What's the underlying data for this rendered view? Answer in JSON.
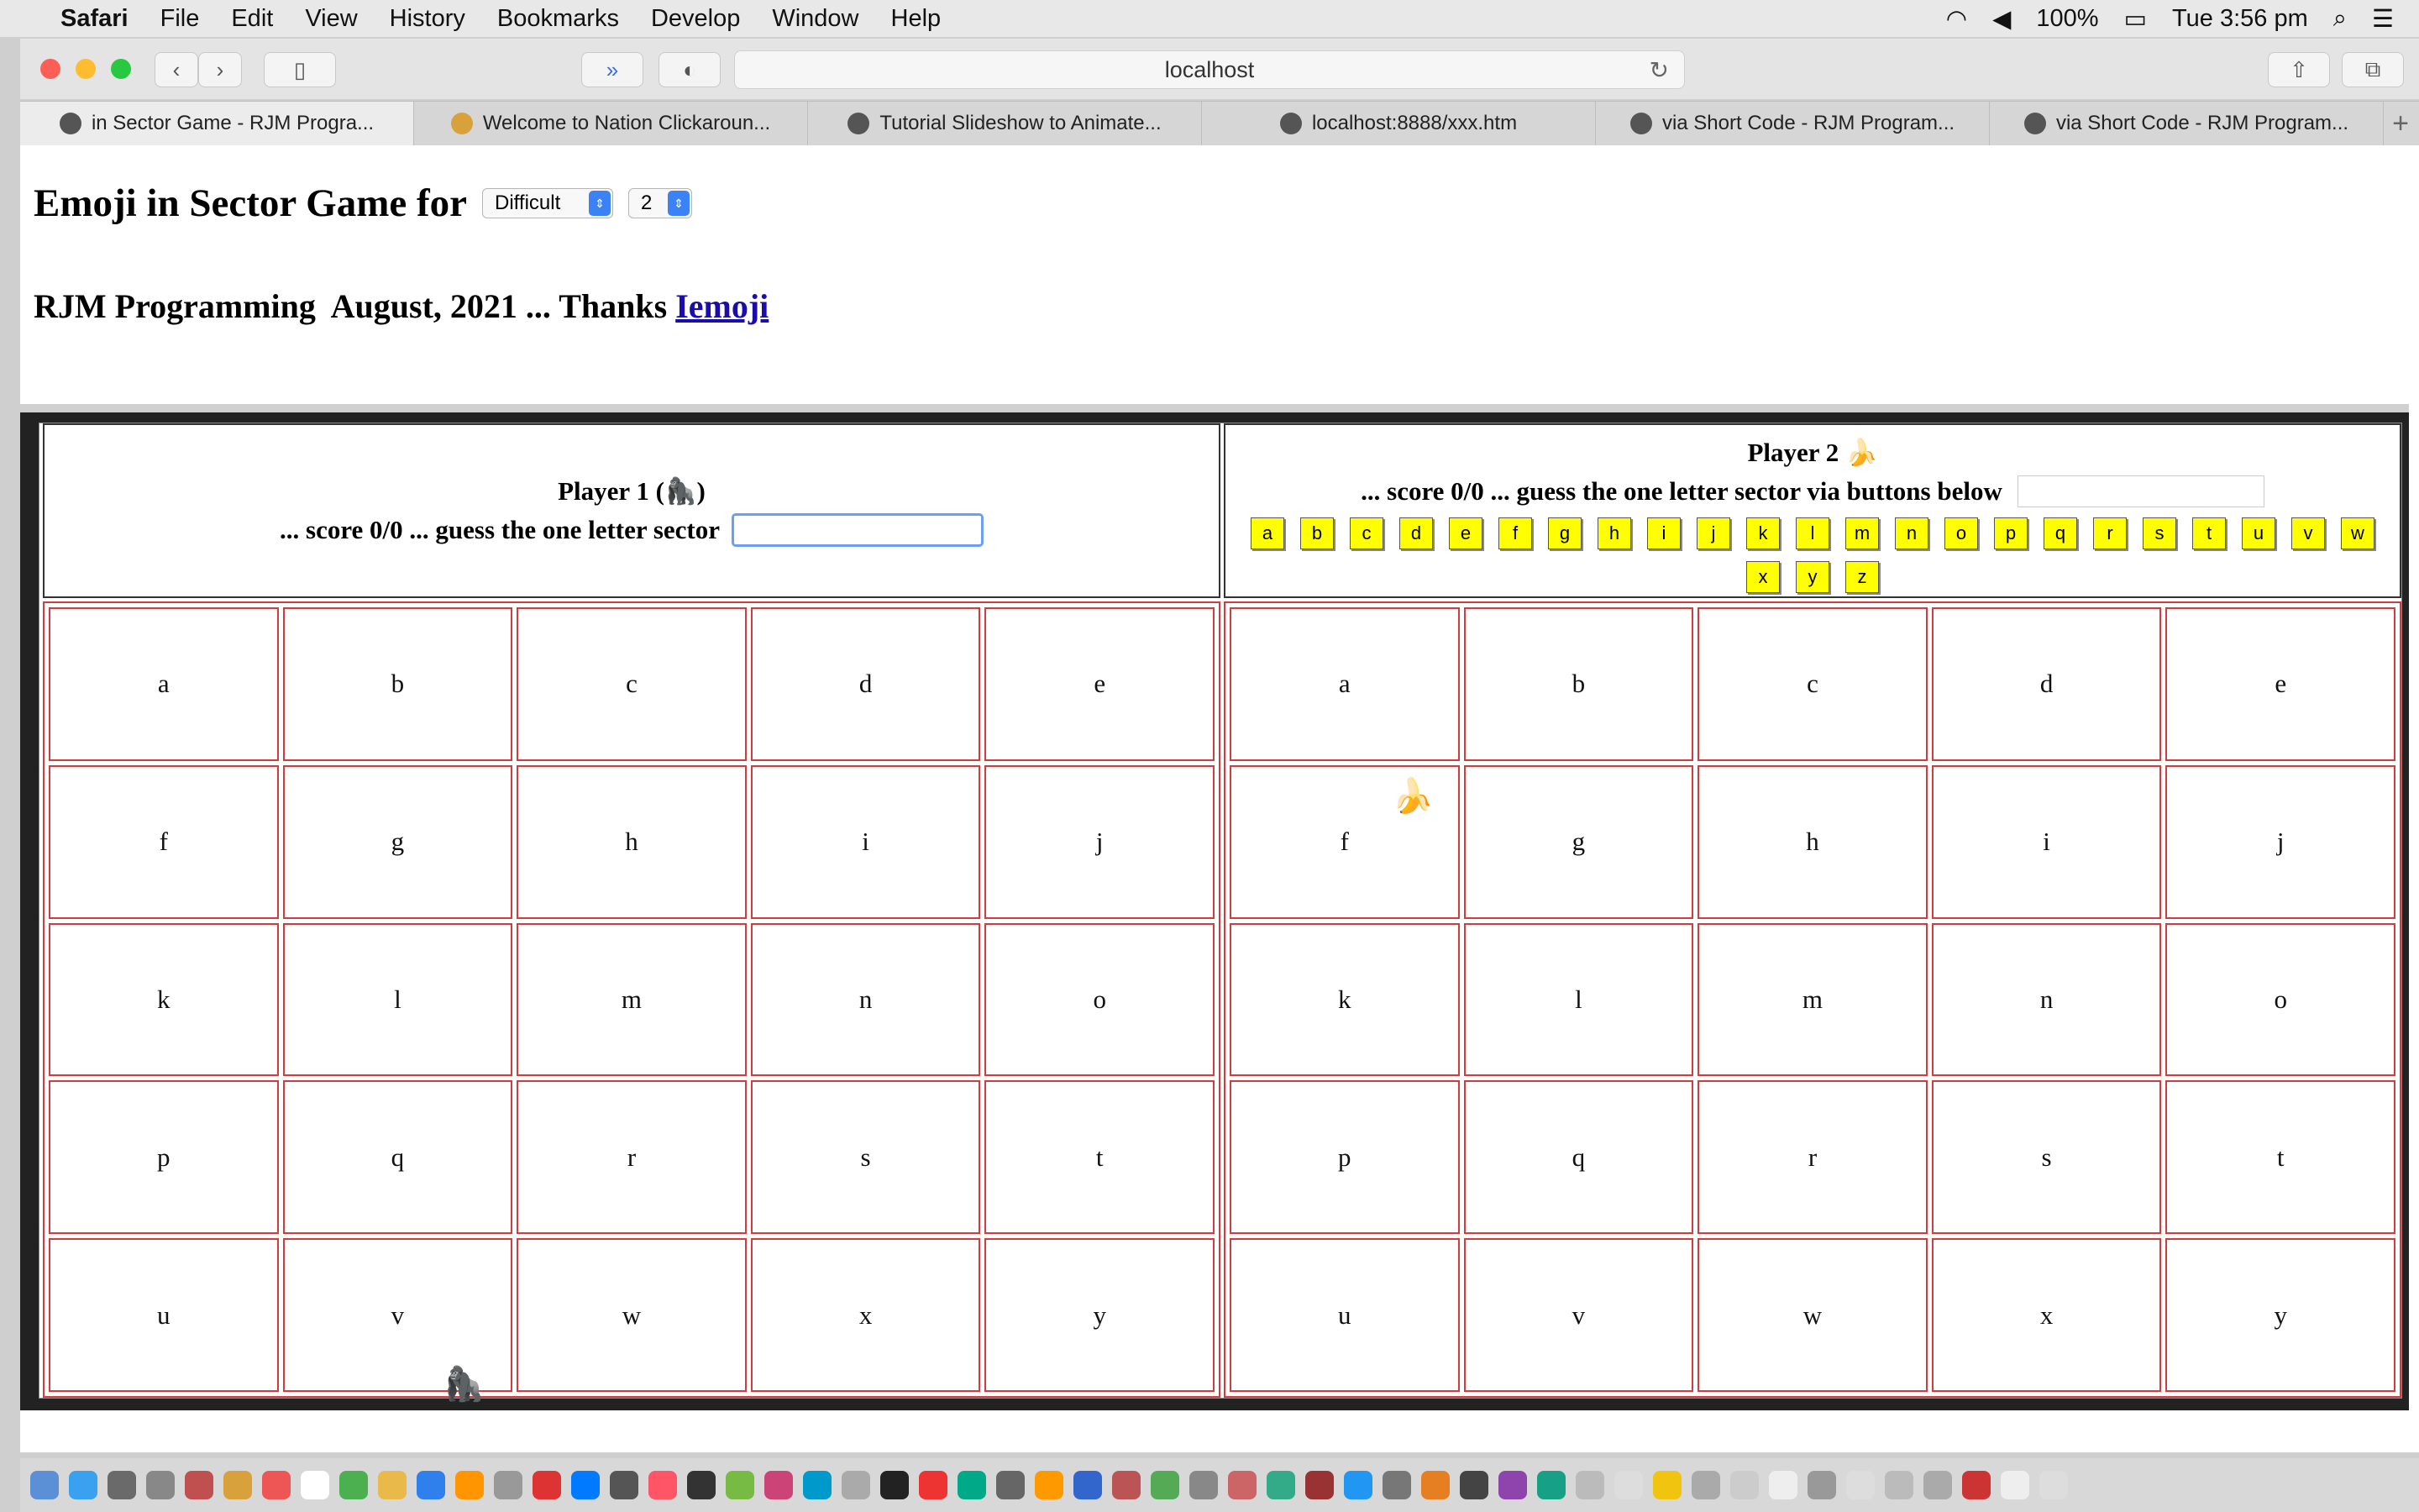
{
  "menubar": {
    "app": "Safari",
    "items": [
      "File",
      "Edit",
      "View",
      "History",
      "Bookmarks",
      "Develop",
      "Window",
      "Help"
    ],
    "battery": "100%",
    "clock": "Tue 3:56 pm"
  },
  "browser": {
    "url": "localhost",
    "tabs": [
      "in Sector Game - RJM Progra...",
      "Welcome to Nation Clickaroun...",
      "Tutorial Slideshow to Animate...",
      "localhost:8888/xxx.htm",
      "via Short Code - RJM Program...",
      "via Short Code - RJM Program..."
    ],
    "new_tab": "+"
  },
  "page": {
    "title": "Emoji in Sector Game for",
    "difficulty": "Difficult",
    "players": "2",
    "byline_prefix": "RJM Programming  August, 2021 ... Thanks ",
    "byline_link": "Iemoji"
  },
  "player1": {
    "heading": "Player 1 (🦍)",
    "prompt": "... score 0/0 ... guess the one letter sector",
    "emoji": "🦍"
  },
  "player2": {
    "heading": "Player 2 🍌",
    "prompt": "... score 0/0 ... guess the one letter sector via buttons below",
    "emoji": "🍌",
    "letter_buttons": [
      "a",
      "b",
      "c",
      "d",
      "e",
      "f",
      "g",
      "h",
      "i",
      "j",
      "k",
      "l",
      "m",
      "n",
      "o",
      "p",
      "q",
      "r",
      "s",
      "t",
      "u",
      "v",
      "w",
      "x",
      "y",
      "z"
    ]
  },
  "board_letters": [
    "a",
    "b",
    "c",
    "d",
    "e",
    "f",
    "g",
    "h",
    "i",
    "j",
    "k",
    "l",
    "m",
    "n",
    "o",
    "p",
    "q",
    "r",
    "s",
    "t",
    "u",
    "v",
    "w",
    "x",
    "y"
  ],
  "colors": {
    "cell_border": "#d23c3c",
    "letter_button": "#ffff00",
    "link": "#1a0dab"
  }
}
